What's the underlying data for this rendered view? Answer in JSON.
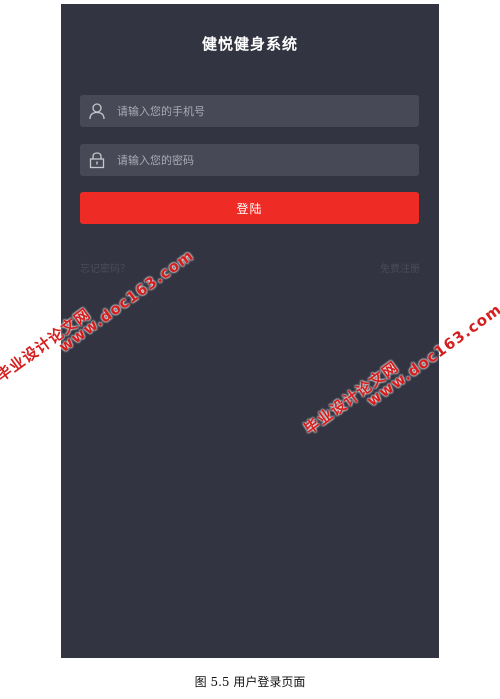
{
  "app": {
    "title": "健悦健身系统"
  },
  "form": {
    "phone_placeholder": "请输入您的手机号",
    "password_placeholder": "请输入您的密码",
    "login_label": "登陆",
    "forgot_link": "忘记密码？",
    "register_link": "免费注册"
  },
  "icons": {
    "phone_field": "user-icon",
    "password_field": "lock-icon"
  },
  "colors": {
    "background": "#323441",
    "field": "#474a56",
    "login_button": "#ee2b24"
  },
  "watermarks": [
    {
      "url": "www.doc163.com",
      "text": "毕业设计论文网"
    },
    {
      "url": "www.doc163.com",
      "text": "毕业设计论文网"
    }
  ],
  "caption": "图 5.5 用户登录页面"
}
